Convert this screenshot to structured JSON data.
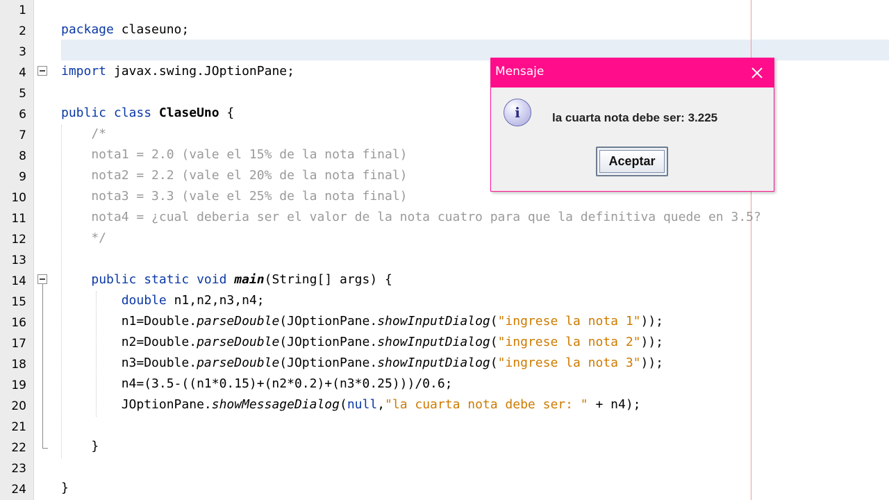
{
  "editor": {
    "line_numbers": [
      "1",
      "2",
      "3",
      "4",
      "5",
      "6",
      "7",
      "8",
      "9",
      "10",
      "11",
      "12",
      "13",
      "14",
      "15",
      "16",
      "17",
      "18",
      "19",
      "20",
      "21",
      "22",
      "23",
      "24"
    ],
    "lines": {
      "l2": {
        "kw": "package",
        "rest": " claseuno;"
      },
      "l4": {
        "kw": "import",
        "rest": " javax.swing.JOptionPane;"
      },
      "l6": {
        "kw": "public class ",
        "cls": "ClaseUno",
        "rest": " {"
      },
      "l7": "    /*",
      "l8": "    nota1 = 2.0 (vale el 15% de la nota final)",
      "l9": "    nota2 = 2.2 (vale el 20% de la nota final)",
      "l10": "    nota3 = 3.3 (vale el 25% de la nota final)",
      "l11": "    nota4 = ¿cual deberia ser el valor de la nota cuatro para que la definitiva quede en 3.5?",
      "l12": "    */",
      "l14": {
        "indent": "    ",
        "kw": "public static void ",
        "method": "main",
        "rest": "(String[] args) {"
      },
      "l15": {
        "indent": "        ",
        "kw": "double",
        "rest": " n1,n2,n3,n4;"
      },
      "l16": {
        "a": "        n1=Double.",
        "m1": "parseDouble",
        "b": "(JOptionPane.",
        "m2": "showInputDialog",
        "c": "(",
        "str": "\"ingrese la nota 1\"",
        "d": "));"
      },
      "l17": {
        "a": "        n2=Double.",
        "m1": "parseDouble",
        "b": "(JOptionPane.",
        "m2": "showInputDialog",
        "c": "(",
        "str": "\"ingrese la nota 2\"",
        "d": "));"
      },
      "l18": {
        "a": "        n3=Double.",
        "m1": "parseDouble",
        "b": "(JOptionPane.",
        "m2": "showInputDialog",
        "c": "(",
        "str": "\"ingrese la nota 3\"",
        "d": "));"
      },
      "l19": "        n4=(3.5-((n1*0.15)+(n2*0.2)+(n3*0.25)))/0.6;",
      "l20": {
        "a": "        JOptionPane.",
        "m": "showMessageDialog",
        "b": "(",
        "kw": "null",
        "c": ",",
        "str": "\"la cuarta nota debe ser: \"",
        "d": " + n4);"
      },
      "l22": "    }",
      "l24": "}"
    }
  },
  "dialog": {
    "title": "Mensaje",
    "close_glyph": "✕",
    "info_glyph": "i",
    "message": "la cuarta nota debe ser: 3.225",
    "button_label": "Aceptar"
  },
  "colors": {
    "keyword": "#0b38a6",
    "comment": "#9a9a9a",
    "string": "#ce7b00",
    "dialog_title_bar": "#ff0d8a"
  }
}
